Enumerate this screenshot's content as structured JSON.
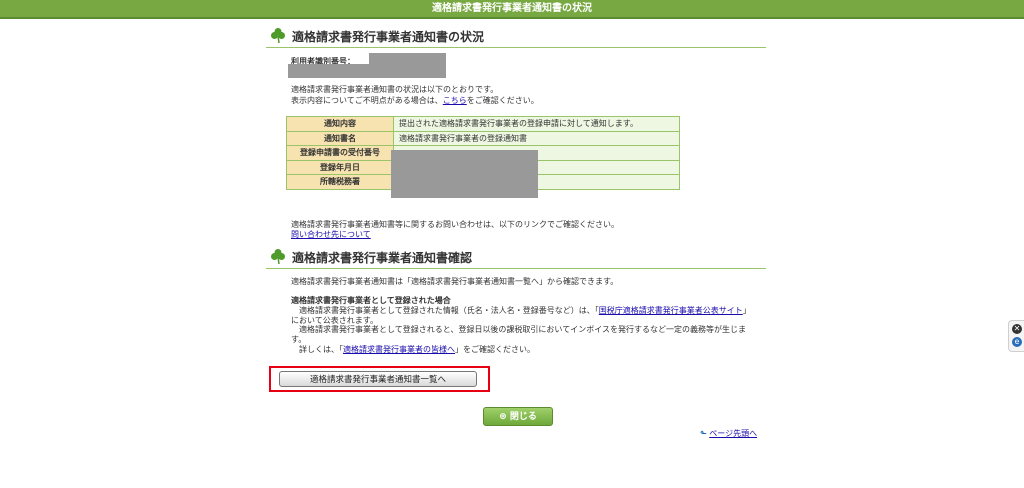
{
  "window_title": "適格請求書発行事業者通知書の状況",
  "section1": {
    "heading": "適格請求書発行事業者通知書の状況",
    "user_id_label": "利用者識別番号：",
    "intro_line1": "適格請求書発行事業者通知書の状況は以下のとおりです。",
    "intro_line2_before": "表示内容についてご不明点がある場合は、",
    "intro_line2_link": "こちら",
    "intro_line2_after": "をご確認ください。"
  },
  "info_table": {
    "rows": [
      {
        "label": "通知内容",
        "value": "提出された適格請求書発行事業者の登録申請に対して通知します。"
      },
      {
        "label": "通知書名",
        "value": "適格請求書発行事業者の登録通知書"
      },
      {
        "label": "登録申請書の受付番号",
        "value": ""
      },
      {
        "label": "登録年月日",
        "value": ""
      },
      {
        "label": "所轄税務署",
        "value": ""
      }
    ]
  },
  "inquiry": {
    "text": "適格請求書発行事業者通知書等に関するお問い合わせは、以下のリンクでご確認ください。",
    "link": "問い合わせ先について"
  },
  "section2": {
    "heading": "適格請求書発行事業者通知書確認",
    "line1": "適格請求書発行事業者通知書は「適格請求書発行事業者通知書一覧へ」から確認できます。",
    "bold_title": "適格請求書発行事業者として登録された場合",
    "p1_before": "適格請求書発行事業者として登録された情報（氏名・法人名・登録番号など）は、「",
    "p1_link": "国税庁適格請求書発行事業者公表サイト",
    "p1_after": "」",
    "p1_line2": "において公表されます。",
    "p2_line1": "適格請求書発行事業者として登録されると、登録日以後の課税取引においてインボイスを発行するなど一定の義務等が生じま",
    "p2_line2": "す。",
    "p3_before": "詳しくは、「",
    "p3_link": "適格請求書発行事業者の皆様へ",
    "p3_after": "」をご確認ください。"
  },
  "buttons": {
    "list_label": "適格請求書発行事業者通知書一覧へ",
    "close_label": "閉じる",
    "close_icon": "circle-x-icon"
  },
  "page_top": {
    "label": "ページ先頭へ",
    "icon": "arrow-up-icon"
  },
  "colors": {
    "accent": "#78a842",
    "highlight": "#e60012"
  }
}
